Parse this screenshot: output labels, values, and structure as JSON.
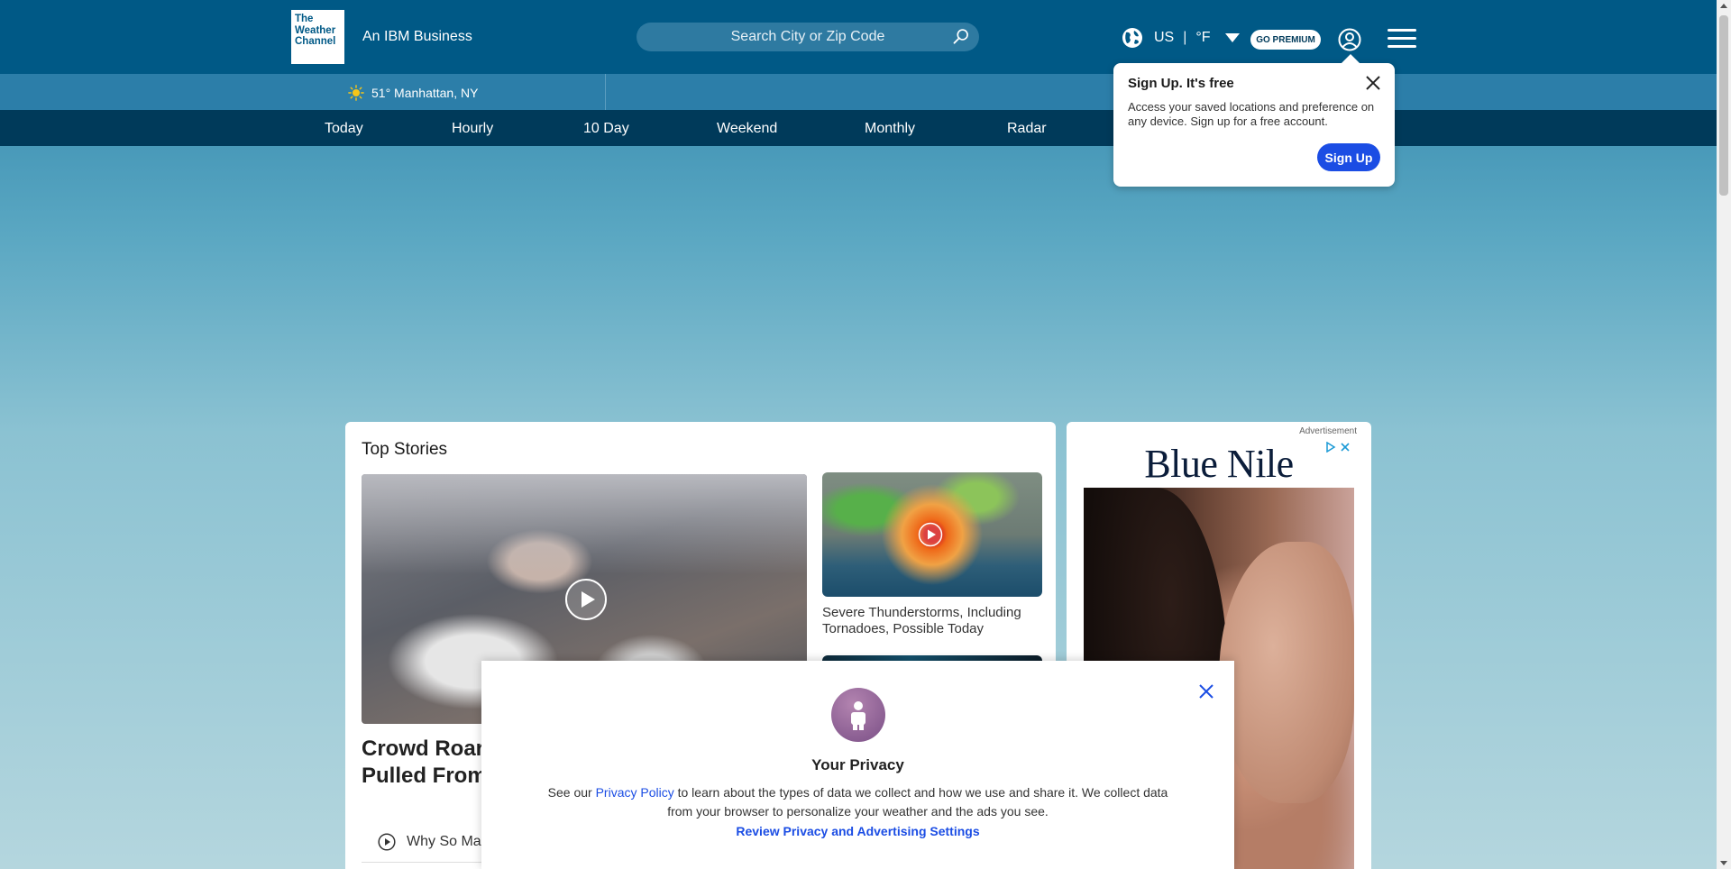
{
  "header": {
    "logo_lines": [
      "The",
      "Weather",
      "Channel"
    ],
    "tagline": "An IBM Business",
    "search_placeholder": "Search City or Zip Code",
    "locale": "US",
    "unit": "°F",
    "premium": "GO PREMIUM"
  },
  "location_bar": {
    "current": "51° Manhattan, NY"
  },
  "nav": {
    "items": [
      "Today",
      "Hourly",
      "10 Day",
      "Weekend",
      "Monthly",
      "Radar"
    ]
  },
  "signup_popover": {
    "title": "Sign Up. It's free",
    "text": "Access your saved locations and preference on any device. Sign up for a free account.",
    "button": "Sign Up"
  },
  "top_stories": {
    "title": "Top Stories",
    "headline": "Crowd Roar\nPulled From",
    "side_caption": "Severe Thunderstorms, Including Tornadoes, Possible Today",
    "related": "Why So Ma"
  },
  "ad": {
    "label": "Advertisement",
    "brand": "Blue Nile"
  },
  "privacy": {
    "title": "Your Privacy",
    "text_before": "See our ",
    "policy_link": "Privacy Policy",
    "text_after": " to learn about the types of data we collect and how we use and share it. We collect data from your browser to personalize your weather and the ads you see.",
    "settings_link": "Review Privacy and Advertising Settings"
  },
  "colors": {
    "header_bg": "#005986",
    "nav_bg": "#003a5a",
    "accent_blue": "#1b4de4"
  }
}
